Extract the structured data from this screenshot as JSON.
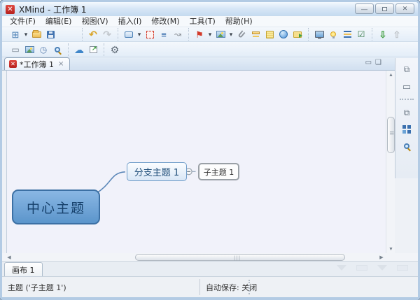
{
  "window": {
    "title": "XMind - 工作簿 1",
    "app_icon": "xmind-logo",
    "controls": [
      {
        "name": "minimize",
        "glyph": "—"
      },
      {
        "name": "maximize",
        "glyph": "restore-shape"
      },
      {
        "name": "close",
        "glyph": "×"
      }
    ]
  },
  "menu": {
    "items": [
      "文件(F)",
      "编辑(E)",
      "视图(V)",
      "插入(I)",
      "修改(M)",
      "工具(T)",
      "帮助(H)"
    ]
  },
  "toolbar_row1": {
    "groups": [
      [
        "new-document",
        "dropdown",
        "open-folder",
        "save"
      ],
      [
        "undo",
        "redo"
      ],
      [
        "insert-topic",
        "dropdown",
        "boundary",
        "summary",
        "relationship"
      ],
      [
        "marker-flag",
        "dropdown",
        "insert-image",
        "dropdown",
        "attachment",
        "label",
        "notes",
        "hyperlink",
        "audio-notes"
      ],
      [
        "presentation",
        "brainstorming",
        "drill-down",
        "task"
      ],
      [
        "share-download",
        "share-upload"
      ]
    ]
  },
  "toolbar_row2": {
    "groups": [
      [
        "frame",
        "style",
        "timer",
        "zoom-page"
      ],
      [
        "cloud-upload",
        "export"
      ],
      [
        "settings-gear"
      ]
    ]
  },
  "editor_tabs": {
    "active_tab": {
      "label": "*工作簿 1",
      "close": "×"
    },
    "pane_buttons": [
      "minimize-pane",
      "restore-pane"
    ]
  },
  "right_panel": {
    "groups": [
      [
        "restore-panes",
        "properties-panel"
      ],
      [
        "restore-panes-2",
        "outline-view",
        "zoom-panel"
      ]
    ]
  },
  "mindmap": {
    "central_topic": "中心主题",
    "branch_topic": "分支主题 1",
    "sub_topic": "子主题 1"
  },
  "sheet_bar": {
    "active_sheet": "画布 1"
  },
  "status_bar": {
    "left": "主题 ('子主题 1')",
    "right": "自动保存: 关闭"
  },
  "colors": {
    "central_fill": "#6aa2d8",
    "central_border": "#3c70a4",
    "branch_border": "#6f9cc9",
    "selection_border": "#9aa0a6",
    "canvas_bg": "#f1f2fa",
    "accent_red_logo": "#c8211e"
  }
}
